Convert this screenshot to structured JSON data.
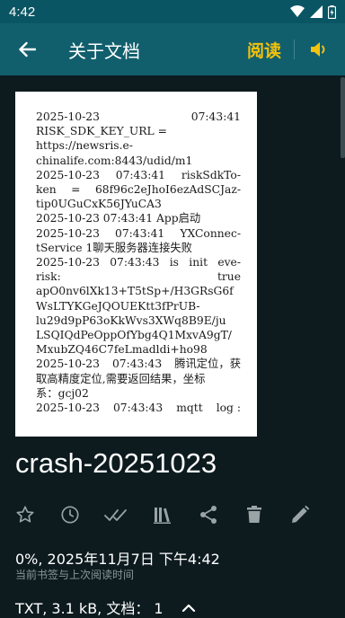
{
  "status_bar": {
    "time": "4:42"
  },
  "app_bar": {
    "title": "关于文档",
    "read_label": "阅读"
  },
  "document_preview": {
    "lines": [
      {
        "text": "2025-10-23            07:43:41",
        "justify": true,
        "parts": [
          "2025-10-23",
          "07:43:41"
        ]
      },
      {
        "text": "RISK_SDK_KEY_URL =",
        "justify": false
      },
      {
        "text": "https://newsris.e-",
        "justify": false
      },
      {
        "text": "chinalife.com:8443/udid/m1",
        "justify": false
      },
      {
        "text": "2025-10-23  07:43:41  riskSdkTo-",
        "justify": true,
        "parts": [
          "2025-10-23",
          "07:43:41",
          "riskSdkTo-"
        ]
      },
      {
        "text": "ken  =  68f96c2eJhoI6ezAdSCJaz-",
        "justify": true,
        "parts": [
          "ken",
          "=",
          "68f96c2eJhoI6ezAdSCJaz-"
        ]
      },
      {
        "text": "tip0UGuCxK56JYuCA3",
        "justify": false
      },
      {
        "text": "2025-10-23 07:43:41 App启动",
        "justify": false
      },
      {
        "text": "2025-10-23  07:43:41  YXConnec-",
        "justify": true,
        "parts": [
          "2025-10-23",
          "07:43:41",
          "YXConnec-"
        ]
      },
      {
        "text": "tService 1聊天服务器连接失败",
        "justify": false
      },
      {
        "text": "2025-10-23  07:43:43  is init  eve-",
        "justify": true,
        "parts": [
          "2025-10-23",
          "07:43:43",
          "is",
          "init",
          "eve-"
        ]
      },
      {
        "text": "risk:                          true",
        "justify": true,
        "parts": [
          "risk:",
          "true"
        ]
      },
      {
        "text": "apO0nv6lXk13+T5tSp+/H3GRsG6f",
        "justify": false
      },
      {
        "text": "WsLTYKGeJQOUEKtt3fPrUB-",
        "justify": false
      },
      {
        "text": "lu29d9pP63oKkWvs3XWq8B9E/ju",
        "justify": false
      },
      {
        "text": "LSQIQdPeOppOfYbg4Q1MxvA9gT/",
        "justify": false
      },
      {
        "text": "MxubZQ46C7feLmadldi+ho98",
        "justify": false
      },
      {
        "text": "2025-10-23  07:43:43  腾讯定位，获",
        "justify": true,
        "parts": [
          "2025-10-23",
          "07:43:43",
          "腾讯定位，获"
        ]
      },
      {
        "text": "取高精度定位,需要返回结果，坐标",
        "justify": false
      },
      {
        "text": "系：gcj02",
        "justify": false
      },
      {
        "text": "2025-10-23  07:43:43  mqtt  log :",
        "justify": true,
        "parts": [
          "2025-10-23",
          "07:43:43",
          "mqtt",
          "log :"
        ]
      }
    ]
  },
  "file": {
    "name": "crash-20251023",
    "progress_and_time": "0%, 2025年11月7日 下午4:42",
    "progress_caption": "当前书签与上次阅读时间",
    "info": "TXT, 3.1 kB, 文档： 1"
  },
  "actions": [
    {
      "name": "favorite",
      "icon": "star-outline-icon"
    },
    {
      "name": "history",
      "icon": "clock-icon"
    },
    {
      "name": "mark-read",
      "icon": "double-check-icon"
    },
    {
      "name": "library",
      "icon": "library-icon"
    },
    {
      "name": "share",
      "icon": "share-icon"
    },
    {
      "name": "delete",
      "icon": "trash-icon"
    },
    {
      "name": "edit",
      "icon": "pencil-icon"
    }
  ],
  "colors": {
    "app_bar": "#115f6d",
    "status_bar": "#0a5563",
    "background": "#0d1b1f",
    "accent": "#f4c20d",
    "icon_gray": "#9aa3a6"
  }
}
